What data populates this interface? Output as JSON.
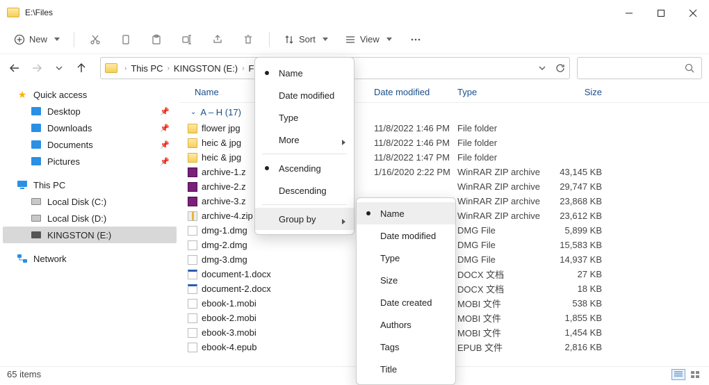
{
  "window": {
    "title": "E:\\Files"
  },
  "toolbar": {
    "new_label": "New",
    "sort_label": "Sort",
    "view_label": "View"
  },
  "breadcrumbs": [
    "This PC",
    "KINGSTON (E:)",
    "File"
  ],
  "sidebar": {
    "quick_access": "Quick access",
    "quick_items": [
      {
        "label": "Desktop"
      },
      {
        "label": "Downloads"
      },
      {
        "label": "Documents"
      },
      {
        "label": "Pictures"
      }
    ],
    "this_pc": "This PC",
    "drives": [
      {
        "label": "Local Disk (C:)"
      },
      {
        "label": "Local Disk (D:)"
      },
      {
        "label": "KINGSTON (E:)"
      }
    ],
    "network": "Network"
  },
  "columns": {
    "name": "Name",
    "date": "Date modified",
    "type": "Type",
    "size": "Size"
  },
  "group": {
    "label": "A – H (17)"
  },
  "files": [
    {
      "icon": "folder",
      "name": "flower jpg",
      "date": "11/8/2022 1:46 PM",
      "type": "File folder",
      "size": ""
    },
    {
      "icon": "folder",
      "name": "heic & jpg",
      "date": "11/8/2022 1:46 PM",
      "type": "File folder",
      "size": ""
    },
    {
      "icon": "folder",
      "name": "heic & jpg",
      "date": "11/8/2022 1:47 PM",
      "type": "File folder",
      "size": ""
    },
    {
      "icon": "rar",
      "name": "archive-1.z",
      "date": "1/16/2020 2:22 PM",
      "type": "WinRAR ZIP archive",
      "size": "43,145 KB"
    },
    {
      "icon": "rar",
      "name": "archive-2.z",
      "date": "",
      "type": "WinRAR ZIP archive",
      "size": "29,747 KB"
    },
    {
      "icon": "rar",
      "name": "archive-3.z",
      "date": "",
      "type": "WinRAR ZIP archive",
      "size": "23,868 KB"
    },
    {
      "icon": "zip",
      "name": "archive-4.zip",
      "date": "",
      "type": "WinRAR ZIP archive",
      "size": "23,612 KB"
    },
    {
      "icon": "dmg",
      "name": "dmg-1.dmg",
      "date": "",
      "type": "DMG File",
      "size": "5,899 KB"
    },
    {
      "icon": "dmg",
      "name": "dmg-2.dmg",
      "date": "",
      "type": "DMG File",
      "size": "15,583 KB"
    },
    {
      "icon": "dmg",
      "name": "dmg-3.dmg",
      "date": "",
      "type": "DMG File",
      "size": "14,937 KB"
    },
    {
      "icon": "doc",
      "name": "document-1.docx",
      "date": "",
      "type": "DOCX 文档",
      "size": "27 KB"
    },
    {
      "icon": "doc",
      "name": "document-2.docx",
      "date": "",
      "type": "DOCX 文档",
      "size": "18 KB"
    },
    {
      "icon": "mobi",
      "name": "ebook-1.mobi",
      "date": "",
      "type": "MOBI 文件",
      "size": "538 KB"
    },
    {
      "icon": "mobi",
      "name": "ebook-2.mobi",
      "date": "",
      "type": "MOBI 文件",
      "size": "1,855 KB"
    },
    {
      "icon": "mobi",
      "name": "ebook-3.mobi",
      "date": "",
      "type": "MOBI 文件",
      "size": "1,454 KB"
    },
    {
      "icon": "epub",
      "name": "ebook-4.epub",
      "date": "",
      "type": "EPUB 文件",
      "size": "2,816 KB"
    }
  ],
  "status": {
    "items": "65 items"
  },
  "menu1": {
    "items": [
      {
        "label": "Name",
        "dot": true
      },
      {
        "label": "Date modified"
      },
      {
        "label": "Type"
      },
      {
        "label": "More",
        "sub": true
      },
      {
        "sep": true
      },
      {
        "label": "Ascending",
        "dot": true
      },
      {
        "label": "Descending"
      },
      {
        "sep": true
      },
      {
        "label": "Group by",
        "sub": true,
        "hover": true
      }
    ]
  },
  "menu2": {
    "items": [
      {
        "label": "Name",
        "dot": true,
        "hover": true
      },
      {
        "label": "Date modified"
      },
      {
        "label": "Type"
      },
      {
        "label": "Size"
      },
      {
        "label": "Date created"
      },
      {
        "label": "Authors"
      },
      {
        "label": "Tags"
      },
      {
        "label": "Title"
      }
    ]
  }
}
